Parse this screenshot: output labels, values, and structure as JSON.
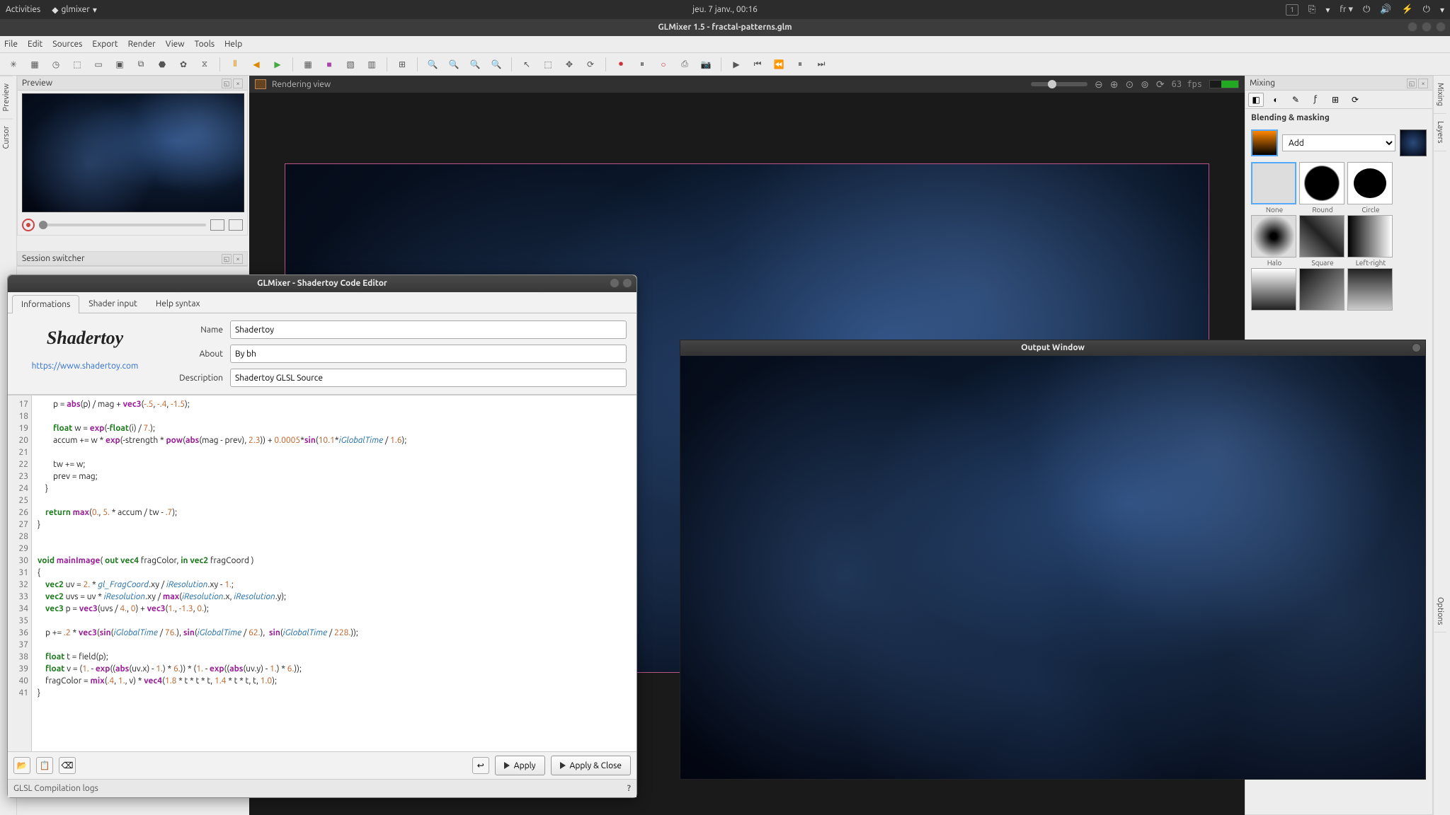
{
  "gnome": {
    "activities": "Activities",
    "app": "glmixer",
    "clock": "jeu.  7 janv., 00:16",
    "indicator": "1",
    "lang": "fr"
  },
  "window": {
    "title": "GLMixer 1.5 - fractal-patterns.glm"
  },
  "menu": [
    "File",
    "Edit",
    "Sources",
    "Export",
    "Render",
    "View",
    "Tools",
    "Help"
  ],
  "rails": {
    "left": [
      "Preview",
      "Cursor"
    ],
    "right": [
      "Mixing",
      "Layers",
      "Options"
    ]
  },
  "preview": {
    "title": "Preview"
  },
  "session": {
    "title": "Session switcher"
  },
  "render": {
    "title": "Rendering view",
    "fps": "63 fps"
  },
  "mixing": {
    "title": "Mixing",
    "section": "Blending & masking",
    "mode": "Add",
    "masks": [
      "None",
      "Round",
      "Circle",
      "Halo",
      "Square",
      "Left-right"
    ]
  },
  "shader": {
    "title": "GLMixer - Shadertoy Code Editor",
    "tabs": [
      "Informations",
      "Shader input",
      "Help syntax"
    ],
    "logo": "Shadertoy",
    "link": "https://www.shadertoy.com",
    "fields": {
      "name_label": "Name",
      "name": "Shadertoy",
      "about_label": "About",
      "about": "By bh",
      "desc_label": "Description",
      "desc": "Shadertoy GLSL Source"
    },
    "buttons": {
      "apply": "Apply",
      "apply_close": "Apply & Close"
    },
    "log": "GLSL Compilation logs",
    "line_start": 17,
    "code_lines": [
      "        p = <fn>abs</fn>(p) / mag + <fn>vec3</fn>(<nu>-.5</nu>, <nu>-.4</nu>, <nu>-1.5</nu>);",
      "",
      "        <ty>float</ty> w = <fn>exp</fn>(-<ty>float</ty>(i) / <nu>7.</nu>);",
      "        accum += w * <fn>exp</fn>(-strength * <fn>pow</fn>(<fn>abs</fn>(mag - prev), <nu>2.3</nu>)) + <nu>0.0005</nu>*<fn>sin</fn>(<nu>10.1</nu>*<id>iGlobalTime</id> / <nu>1.6</nu>);",
      "",
      "        tw += w;",
      "        prev = mag;",
      "    }",
      "",
      "    <kw>return</kw> <fn>max</fn>(<nu>0.</nu>, <nu>5.</nu> * accum / tw - <nu>.7</nu>);",
      "}",
      "",
      "",
      "<ty>void</ty> <fn>mainImage</fn>( <kw>out</kw> <ty>vec4</ty> fragColor, <kw>in</kw> <ty>vec2</ty> fragCoord )",
      "{",
      "    <ty>vec2</ty> uv = <nu>2.</nu> * <id>gl_FragCoord</id>.xy / <id>iResolution</id>.xy - <nu>1.</nu>;",
      "    <ty>vec2</ty> uvs = uv * <id>iResolution</id>.xy / <fn>max</fn>(<id>iResolution</id>.x, <id>iResolution</id>.y);",
      "    <ty>vec3</ty> p = <fn>vec3</fn>(uvs / <nu>4.</nu>, <nu>0</nu>) + <fn>vec3</fn>(<nu>1.</nu>, <nu>-1.3</nu>, <nu>0.</nu>);",
      "",
      "    p += <nu>.2</nu> * <fn>vec3</fn>(<fn>sin</fn>(<id>iGlobalTime</id> / <nu>76.</nu>), <fn>sin</fn>(<id>iGlobalTime</id> / <nu>62.</nu>),  <fn>sin</fn>(<id>iGlobalTime</id> / <nu>228.</nu>));",
      "",
      "    <ty>float</ty> t = field(p);",
      "    <ty>float</ty> v = (<nu>1.</nu> - <fn>exp</fn>((<fn>abs</fn>(uv.x) - <nu>1.</nu>) * <nu>6.</nu>)) * (<nu>1.</nu> - <fn>exp</fn>((<fn>abs</fn>(uv.y) - <nu>1.</nu>) * <nu>6.</nu>));",
      "    fragColor = <fn>mix</fn>(<nu>.4</nu>, <nu>1.</nu>, v) * <fn>vec4</fn>(<nu>1.8</nu> * t * t * t, <nu>1.4</nu> * t * t, t, <nu>1.0</nu>);",
      "}"
    ]
  },
  "output": {
    "title": "Output Window"
  }
}
